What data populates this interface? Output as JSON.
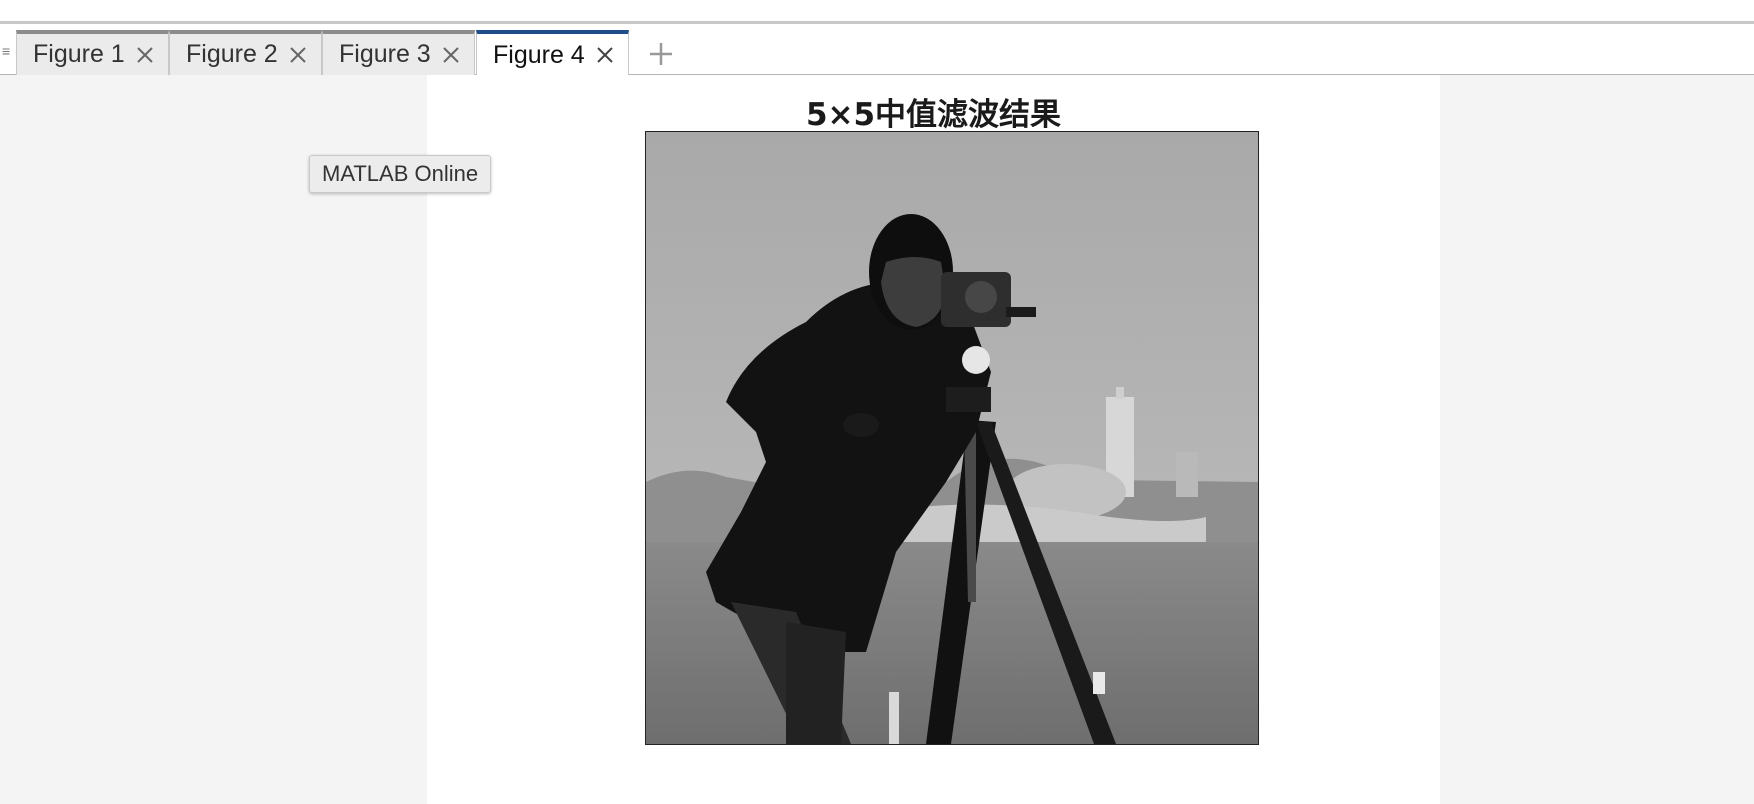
{
  "tabs": [
    {
      "label": "Figure 1",
      "active": false
    },
    {
      "label": "Figure 2",
      "active": false
    },
    {
      "label": "Figure 3",
      "active": false
    },
    {
      "label": "Figure 4",
      "active": true
    }
  ],
  "figure": {
    "title": "5×5中值滤波结果",
    "image_description_icon": "cameraman-image"
  },
  "tooltip": {
    "text": "MATLAB Online"
  },
  "icons": {
    "grip": "grip-icon",
    "close": "close-icon",
    "add": "add-tab-icon"
  },
  "colors": {
    "active_tab_accent": "#1f4e88",
    "inactive_tab_accent": "#8c8c8c",
    "side_panel_bg": "#f4f4f4"
  }
}
